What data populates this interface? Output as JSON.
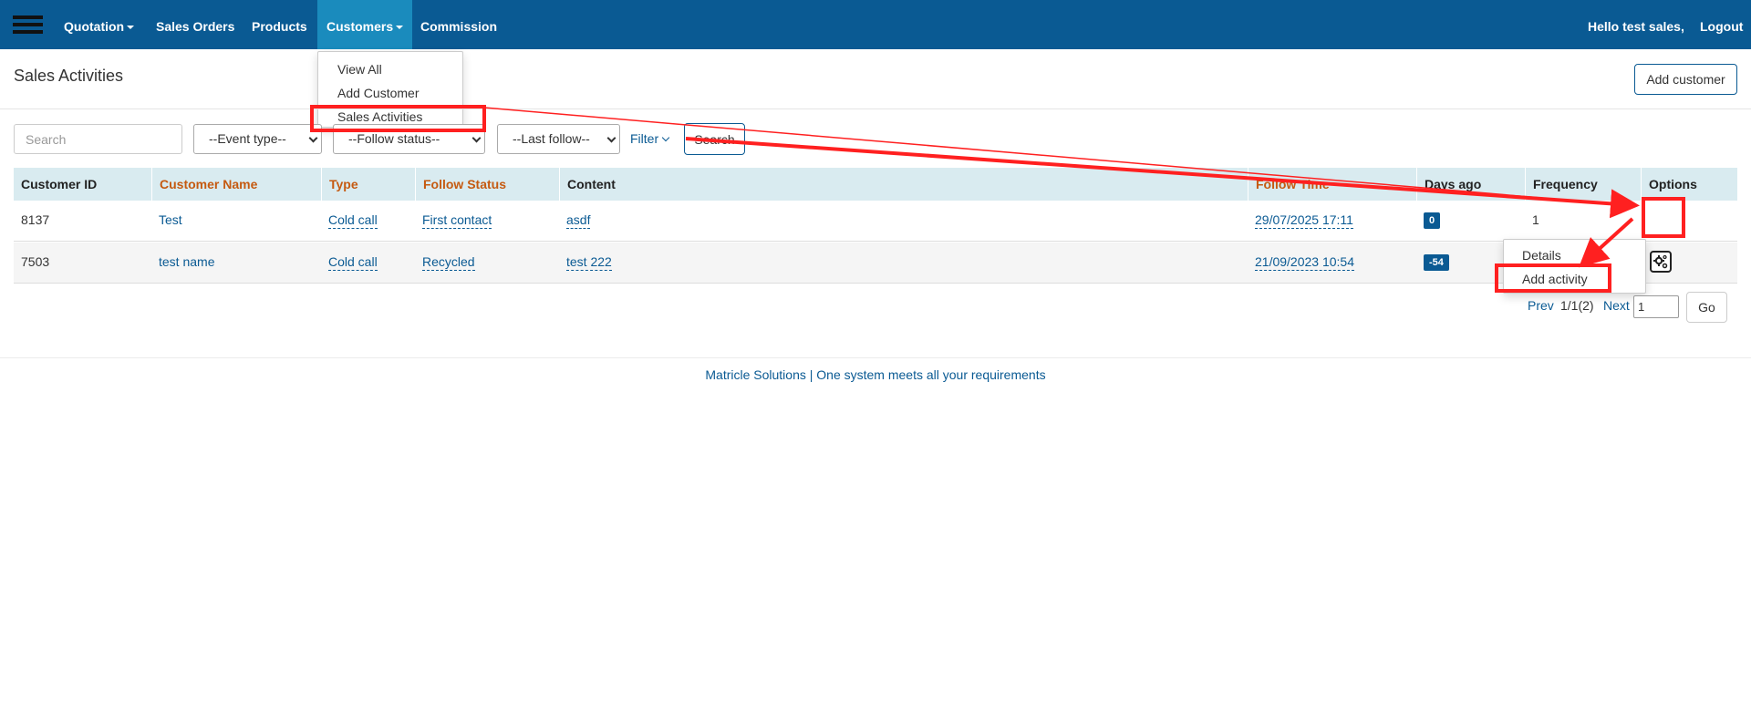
{
  "nav": {
    "items": [
      {
        "label": "Quotation",
        "has_caret": true
      },
      {
        "label": "Sales Orders"
      },
      {
        "label": "Products"
      },
      {
        "label": "Customers",
        "has_caret": true,
        "active": true
      },
      {
        "label": "Commission"
      }
    ],
    "greeting": "Hello test sales,",
    "logout": "Logout"
  },
  "customers_menu": {
    "items": [
      "View All",
      "Add Customer",
      "Sales Activities"
    ]
  },
  "page": {
    "title": "Sales Activities",
    "add_customer": "Add customer"
  },
  "filters": {
    "search_placeholder": "Search",
    "event_type": "--Event type--",
    "follow_status": "--Follow status--",
    "last_follow": "--Last follow--",
    "filter_label": "Filter",
    "search_button": "Search"
  },
  "table": {
    "headers": [
      "Customer ID",
      "Customer Name",
      "Type",
      "Follow Status",
      "Content",
      "Follow Time",
      "Days ago",
      "Frequency",
      "Options"
    ],
    "rows": [
      {
        "id": "8137",
        "name": "Test",
        "type": "Cold call",
        "status": "First contact",
        "content": "asdf",
        "time": "29/07/2025 17:11",
        "days": "0",
        "frequency": "1"
      },
      {
        "id": "7503",
        "name": "test name",
        "type": "Cold call",
        "status": "Recycled",
        "content": "test 222",
        "time": "21/09/2023 10:54",
        "days": "-54",
        "frequency": ""
      }
    ]
  },
  "options_menu": {
    "items": [
      "Details",
      "Add activity"
    ]
  },
  "pagination": {
    "prev": "Prev",
    "info": "1/1(2)",
    "next": "Next",
    "page_value": "1",
    "go": "Go"
  },
  "footer": "Matricle Solutions | One system meets all your requirements",
  "colors": {
    "navbar": "#0a5a93",
    "active_nav": "#1a8bbd",
    "header_bg": "#d9ebf0",
    "header_orange": "#c55a11",
    "annotation_red": "#ff2020"
  }
}
